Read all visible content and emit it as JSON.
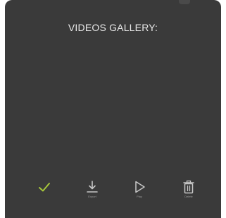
{
  "gallery": {
    "title": "VIDEOS GALLERY:"
  },
  "toolbar": {
    "accent_color": "#a7c73a",
    "icon_color": "#c8c8c8",
    "items": [
      {
        "icon": "check-icon",
        "label": ""
      },
      {
        "icon": "download-icon",
        "label": "Export"
      },
      {
        "icon": "play-icon",
        "label": "Play"
      },
      {
        "icon": "trash-icon",
        "label": "Delete"
      }
    ]
  }
}
